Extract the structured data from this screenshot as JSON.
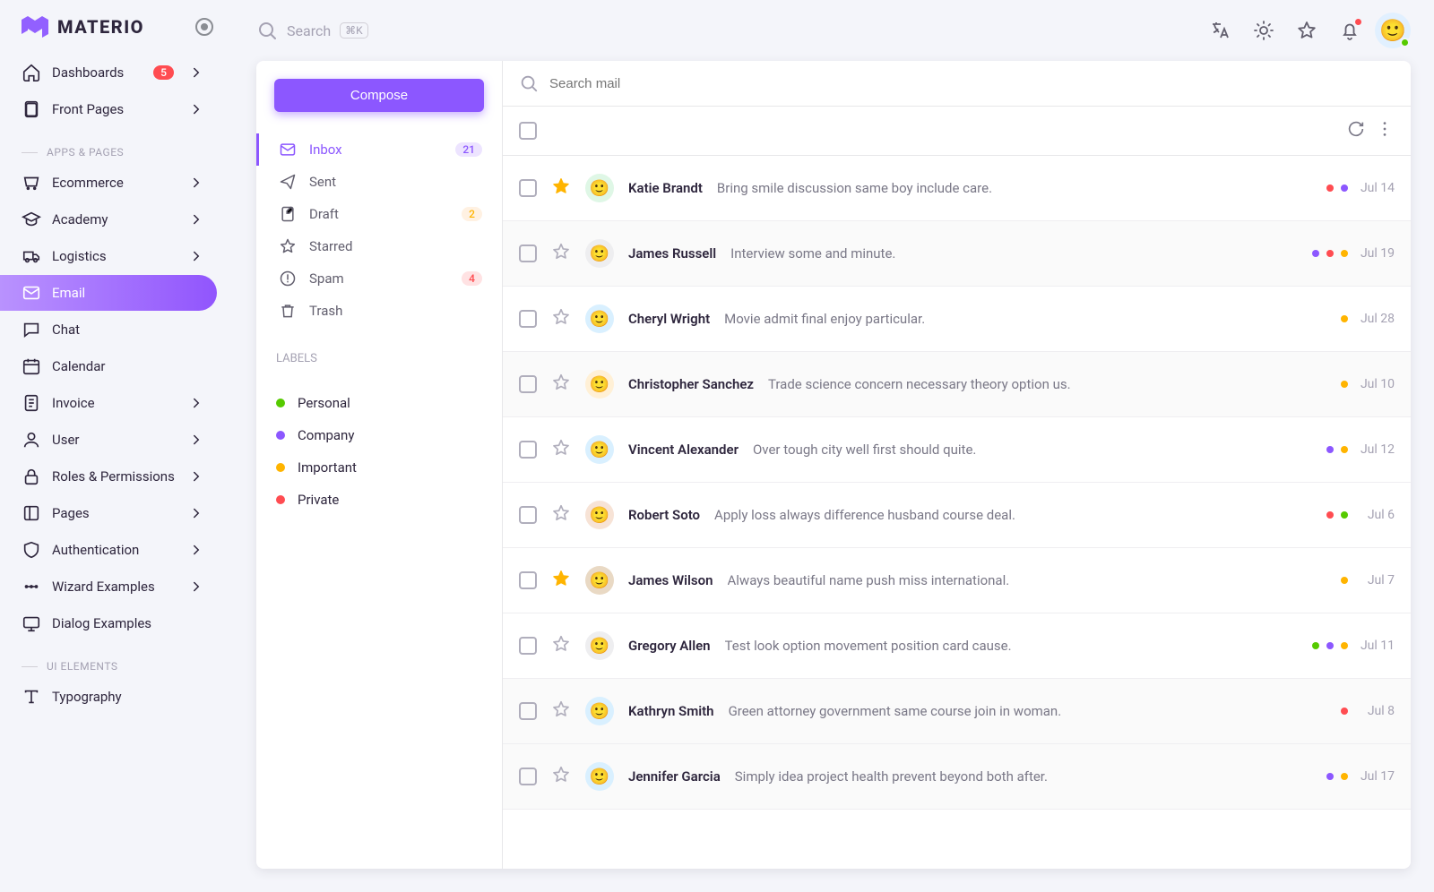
{
  "brand": "MATERIO",
  "topbar": {
    "search_placeholder": "Search",
    "search_kbd": "⌘K"
  },
  "sidebar": {
    "items": [
      {
        "label": "Dashboards",
        "icon": "home",
        "badge": "5",
        "expand": true
      },
      {
        "label": "Front Pages",
        "icon": "file",
        "expand": true
      },
      {
        "section": "APPS & PAGES"
      },
      {
        "label": "Ecommerce",
        "icon": "cart",
        "expand": true
      },
      {
        "label": "Academy",
        "icon": "cap",
        "expand": true
      },
      {
        "label": "Logistics",
        "icon": "truck",
        "expand": true
      },
      {
        "label": "Email",
        "icon": "mail",
        "active": true
      },
      {
        "label": "Chat",
        "icon": "chat"
      },
      {
        "label": "Calendar",
        "icon": "cal"
      },
      {
        "label": "Invoice",
        "icon": "doc",
        "expand": true
      },
      {
        "label": "User",
        "icon": "user",
        "expand": true
      },
      {
        "label": "Roles & Permissions",
        "icon": "lock",
        "expand": true
      },
      {
        "label": "Pages",
        "icon": "page",
        "expand": true
      },
      {
        "label": "Authentication",
        "icon": "shield",
        "expand": true
      },
      {
        "label": "Wizard Examples",
        "icon": "dots",
        "expand": true
      },
      {
        "label": "Dialog Examples",
        "icon": "screen"
      },
      {
        "section": "UI ELEMENTS"
      },
      {
        "label": "Typography",
        "icon": "type"
      }
    ]
  },
  "mail": {
    "compose": "Compose",
    "search_placeholder": "Search mail",
    "labels_title": "LABELS",
    "folders": [
      {
        "label": "Inbox",
        "icon": "mail",
        "badge": "21",
        "badge_class": "bprimary",
        "active": true
      },
      {
        "label": "Sent",
        "icon": "send"
      },
      {
        "label": "Draft",
        "icon": "draft",
        "badge": "2",
        "badge_class": "bwarn"
      },
      {
        "label": "Starred",
        "icon": "star"
      },
      {
        "label": "Spam",
        "icon": "spam",
        "badge": "4",
        "badge_class": "berror"
      },
      {
        "label": "Trash",
        "icon": "trash"
      }
    ],
    "labels": [
      {
        "name": "Personal",
        "color": "c-personal"
      },
      {
        "name": "Company",
        "color": "c-company"
      },
      {
        "name": "Important",
        "color": "c-important"
      },
      {
        "name": "Private",
        "color": "c-private"
      }
    ],
    "messages": [
      {
        "sender": "Katie Brandt",
        "subject": "Bring smile discussion same boy include care.",
        "date": "Jul 14",
        "starred": true,
        "read": false,
        "labels": [
          "c-private",
          "c-company"
        ],
        "av": "#dff7e6"
      },
      {
        "sender": "James Russell",
        "subject": "Interview some and minute.",
        "date": "Jul 19",
        "read": true,
        "labels": [
          "c-company",
          "c-private",
          "c-important"
        ],
        "av": "#eeeef0"
      },
      {
        "sender": "Cheryl Wright",
        "subject": "Movie admit final enjoy particular.",
        "date": "Jul 28",
        "read": false,
        "labels": [
          "c-important"
        ],
        "av": "#d9f0ff"
      },
      {
        "sender": "Christopher Sanchez",
        "subject": "Trade science concern necessary theory option us.",
        "date": "Jul 10",
        "read": true,
        "labels": [
          "c-important"
        ],
        "av": "#fff0d6"
      },
      {
        "sender": "Vincent Alexander",
        "subject": "Over tough city well first should quite.",
        "date": "Jul 12",
        "read": false,
        "labels": [
          "c-company",
          "c-important"
        ],
        "av": "#d9f0ff"
      },
      {
        "sender": "Robert Soto",
        "subject": "Apply loss always difference husband course deal.",
        "date": "Jul 6",
        "read": false,
        "labels": [
          "c-private",
          "c-personal"
        ],
        "av": "#f7e3d6"
      },
      {
        "sender": "James Wilson",
        "subject": "Always beautiful name push miss international.",
        "date": "Jul 7",
        "starred": true,
        "read": false,
        "labels": [
          "c-important"
        ],
        "av": "#e9d9c4"
      },
      {
        "sender": "Gregory Allen",
        "subject": "Test look option movement position card cause.",
        "date": "Jul 11",
        "read": false,
        "labels": [
          "c-personal",
          "c-company",
          "c-important"
        ],
        "av": "#eeeef0"
      },
      {
        "sender": "Kathryn Smith",
        "subject": "Green attorney government same course join in woman.",
        "date": "Jul 8",
        "read": true,
        "labels": [
          "c-private"
        ],
        "av": "#d9f0ff"
      },
      {
        "sender": "Jennifer Garcia",
        "subject": "Simply idea project health prevent beyond both after.",
        "date": "Jul 17",
        "read": true,
        "labels": [
          "c-company",
          "c-important"
        ],
        "av": "#d9f0ff"
      }
    ]
  }
}
